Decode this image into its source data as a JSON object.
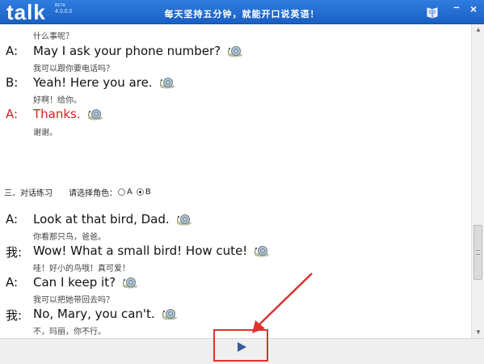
{
  "app": {
    "logo": "talk",
    "logo_sub": "BETA",
    "version": "4.0.0.0",
    "slogan": "每天坚持五分钟，就能开口说英语！"
  },
  "icons": {
    "book": "book-icon",
    "minimize": "minimize-icon",
    "close": "close-icon",
    "snail": "snail-audio-icon",
    "play": "play-icon"
  },
  "dialogue1": [
    {
      "cn": "什么事呢？"
    },
    {
      "speaker": "A:",
      "en": "May I ask your phone number?",
      "cn": "我可以跟你要电话吗？"
    },
    {
      "speaker": "B:",
      "en": "Yeah! Here you are.",
      "cn": "好啊！给你。"
    },
    {
      "speaker": "A:",
      "en": "Thanks.",
      "cn": "谢谢。",
      "highlight": "#d42020"
    }
  ],
  "section": {
    "title": "三、对话练习",
    "role_prompt": "请选择角色：",
    "options": [
      "A",
      "B"
    ],
    "selected": "B"
  },
  "dialogue2": [
    {
      "speaker": "A:",
      "en": "Look at that bird, Dad.",
      "cn": "你看那只鸟，爸爸。"
    },
    {
      "speaker": "我:",
      "en": "Wow! What a small bird! How cute!",
      "cn": "哇！好小的鸟哦！真可爱！"
    },
    {
      "speaker": "A:",
      "en": "Can I keep it?",
      "cn": "我可以把她带回去吗？"
    },
    {
      "speaker": "我:",
      "en": "No, Mary, you can't.",
      "cn": "不，玛丽，你不行。"
    }
  ],
  "colors": {
    "titlebar": "#1f6fd6",
    "highlight_line": "#d42020",
    "annotation": "#e03030",
    "play": "#3a5d99"
  }
}
